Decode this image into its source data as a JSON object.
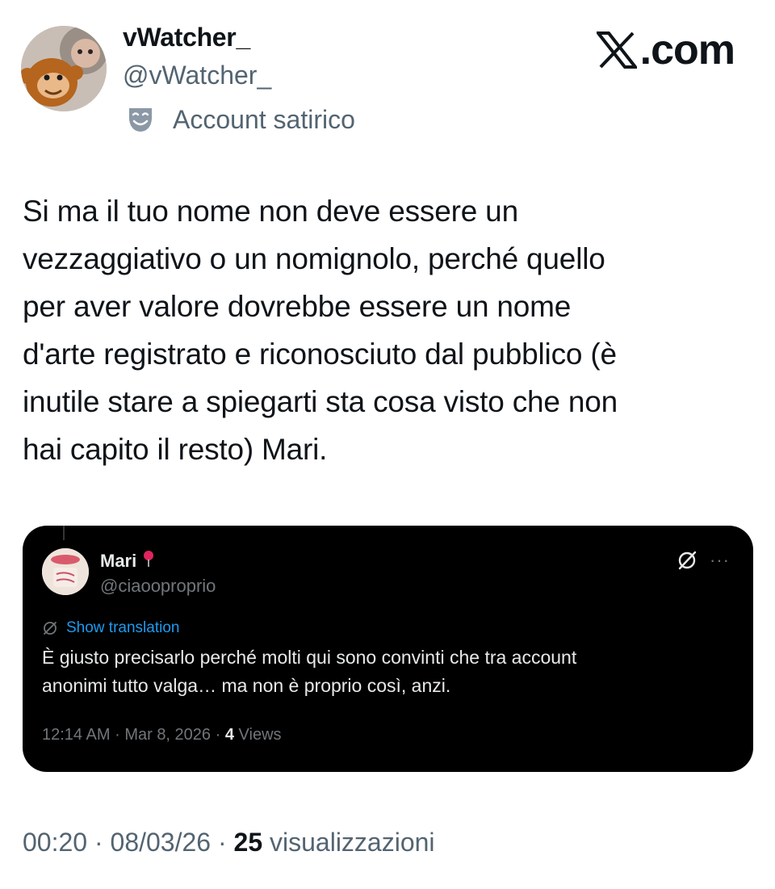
{
  "author": {
    "display_name": "vWatcher_",
    "handle": "@vWatcher_",
    "label": "Account satirico",
    "label_icon": "theater-mask-icon",
    "avatar_icon": "monkey-avatar-icon"
  },
  "brand": {
    "logo_text": ".com",
    "logo_icon": "x-logo-icon"
  },
  "tweet": {
    "lines": [
      "Si ma il tuo nome non deve essere un",
      "vezzaggiativo o un nomignolo, perché quello",
      "per aver valore dovrebbe essere un nome",
      "d'arte registrato e riconosciuto dal pubblico (è",
      "inutile stare a spiegarti sta cosa visto che non",
      "hai capito il resto) Mari."
    ]
  },
  "quote": {
    "display_name": "Mari",
    "name_emoji": "pin-icon",
    "handle": "@ciaooproprio",
    "translate_label": "Show translation",
    "text_lines": [
      "È giusto precisarlo perché molti qui sono convinti che tra account",
      "anonimi tutto valga… ma non è proprio così, anzi."
    ],
    "time": "12:14 AM",
    "date": "Mar 8, 2026",
    "views_count": "4",
    "views_label": "Views",
    "separator": "·",
    "more_label": "···"
  },
  "meta": {
    "time": "00:20",
    "date": "08/03/26",
    "views_count": "25",
    "views_label": "visualizzazioni",
    "separator": "·"
  },
  "colors": {
    "text_primary": "#0f1419",
    "text_secondary": "#536471",
    "quote_bg": "#000000",
    "link_blue": "#1d9bf0"
  }
}
